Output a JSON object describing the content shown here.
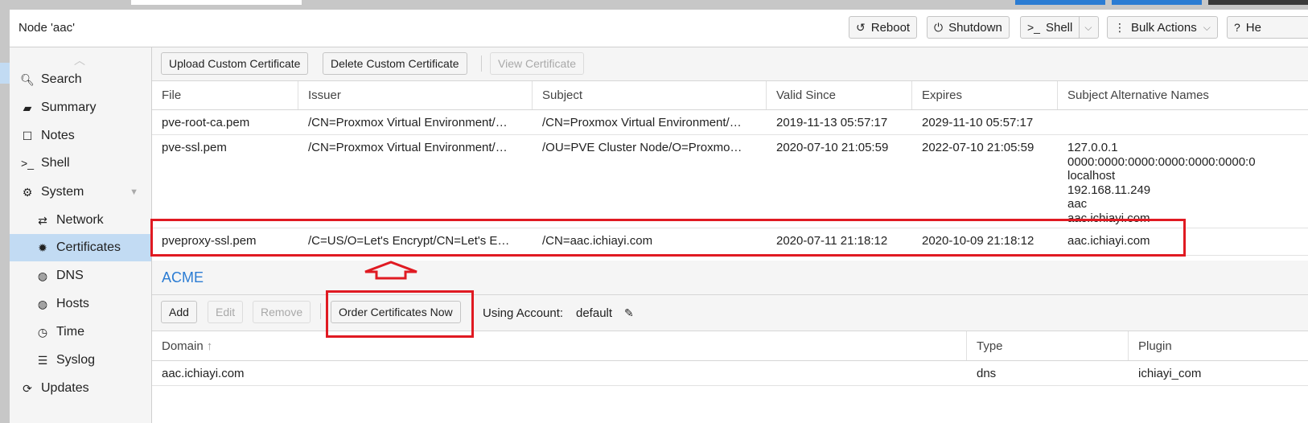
{
  "header": {
    "title": "Node 'aac'",
    "buttons": {
      "reboot": "Reboot",
      "shutdown": "Shutdown",
      "shell": "Shell",
      "bulk_actions": "Bulk Actions",
      "help": "He"
    }
  },
  "sidebar": {
    "items": [
      {
        "label": "Search",
        "icon": "search-icon"
      },
      {
        "label": "Summary",
        "icon": "book-icon"
      },
      {
        "label": "Notes",
        "icon": "note-icon"
      },
      {
        "label": "Shell",
        "icon": "terminal-icon"
      },
      {
        "label": "System",
        "icon": "cogs-icon"
      },
      {
        "label": "Network",
        "icon": "exchange-icon"
      },
      {
        "label": "Certificates",
        "icon": "certificate-icon"
      },
      {
        "label": "DNS",
        "icon": "globe-icon"
      },
      {
        "label": "Hosts",
        "icon": "globe-icon"
      },
      {
        "label": "Time",
        "icon": "clock-icon"
      },
      {
        "label": "Syslog",
        "icon": "list-icon"
      },
      {
        "label": "Updates",
        "icon": "refresh-icon"
      }
    ],
    "active": "Certificates"
  },
  "certificates": {
    "toolbar": {
      "upload": "Upload Custom Certificate",
      "delete": "Delete Custom Certificate",
      "view": "View Certificate"
    },
    "columns": [
      "File",
      "Issuer",
      "Subject",
      "Valid Since",
      "Expires",
      "Subject Alternative Names"
    ],
    "rows": [
      {
        "file": "pve-root-ca.pem",
        "issuer": "/CN=Proxmox Virtual Environment/…",
        "subject": "/CN=Proxmox Virtual Environment/…",
        "valid_since": "2019-11-13 05:57:17",
        "expires": "2029-11-10 05:57:17",
        "san": ""
      },
      {
        "file": "pve-ssl.pem",
        "issuer": "/CN=Proxmox Virtual Environment/…",
        "subject": "/OU=PVE Cluster Node/O=Proxmo…",
        "valid_since": "2020-07-10 21:05:59",
        "expires": "2022-07-10 21:05:59",
        "san": [
          "127.0.0.1",
          "0000:0000:0000:0000:0000:0000:0",
          "localhost",
          "192.168.11.249",
          "aac",
          "aac.ichiayi.com"
        ]
      },
      {
        "file": "pveproxy-ssl.pem",
        "issuer": "/C=US/O=Let's Encrypt/CN=Let's E…",
        "subject": "/CN=aac.ichiayi.com",
        "valid_since": "2020-07-11 21:18:12",
        "expires": "2020-10-09 21:18:12",
        "san": "aac.ichiayi.com"
      }
    ]
  },
  "acme": {
    "title": "ACME",
    "toolbar": {
      "add": "Add",
      "edit": "Edit",
      "remove": "Remove",
      "order": "Order Certificates Now",
      "account_label": "Using Account:",
      "account_value": "default"
    },
    "columns": [
      "Domain",
      "Type",
      "Plugin"
    ],
    "rows": [
      {
        "domain": "aac.ichiayi.com",
        "type": "dns",
        "plugin": "ichiayi_com"
      }
    ]
  },
  "colors": {
    "accent": "#2b7cd3",
    "selection": "#c2dbf3",
    "annotation": "#e01a22"
  }
}
